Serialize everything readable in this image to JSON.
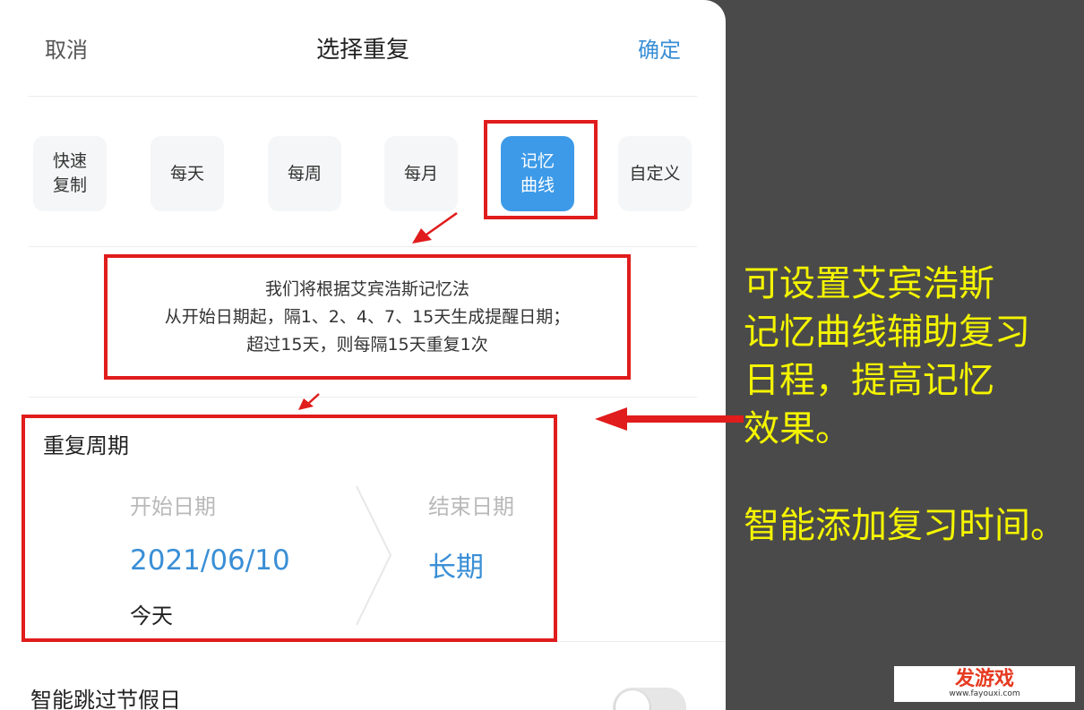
{
  "header": {
    "cancel_label": "取消",
    "title": "选择重复",
    "confirm_label": "确定"
  },
  "repeat_options": [
    {
      "label": "快速\n复制",
      "selected": false
    },
    {
      "label": "每天",
      "selected": false
    },
    {
      "label": "每周",
      "selected": false
    },
    {
      "label": "每月",
      "selected": false
    },
    {
      "label": "记忆\n曲线",
      "selected": true
    },
    {
      "label": "自定义",
      "selected": false
    }
  ],
  "info": {
    "line1": "我们将根据艾宾浩斯记忆法",
    "line2": "从开始日期起，隔1、2、4、7、15天生成提醒日期；",
    "line3": "超过15天，则每隔15天重复1次"
  },
  "period": {
    "label": "重复周期",
    "start_label": "开始日期",
    "start_value": "2021/06/10",
    "start_sub": "今天",
    "end_label": "结束日期",
    "end_value": "长期"
  },
  "skip_holidays": {
    "label": "智能跳过节假日",
    "enabled": false
  },
  "annotation": {
    "text": "可设置艾宾浩斯\n记忆曲线辅助复习\n日程，提高记忆\n效果。\n\n智能添加复习时间。"
  },
  "watermark": {
    "title": "发游戏",
    "url": "www.fayouxi.com"
  },
  "colors": {
    "accent": "#3a8fd6",
    "selected_bg": "#3d9ae8",
    "highlight_red": "#e01c1c",
    "annotation_yellow": "#f4f400",
    "backdrop": "#4a4a4a"
  }
}
